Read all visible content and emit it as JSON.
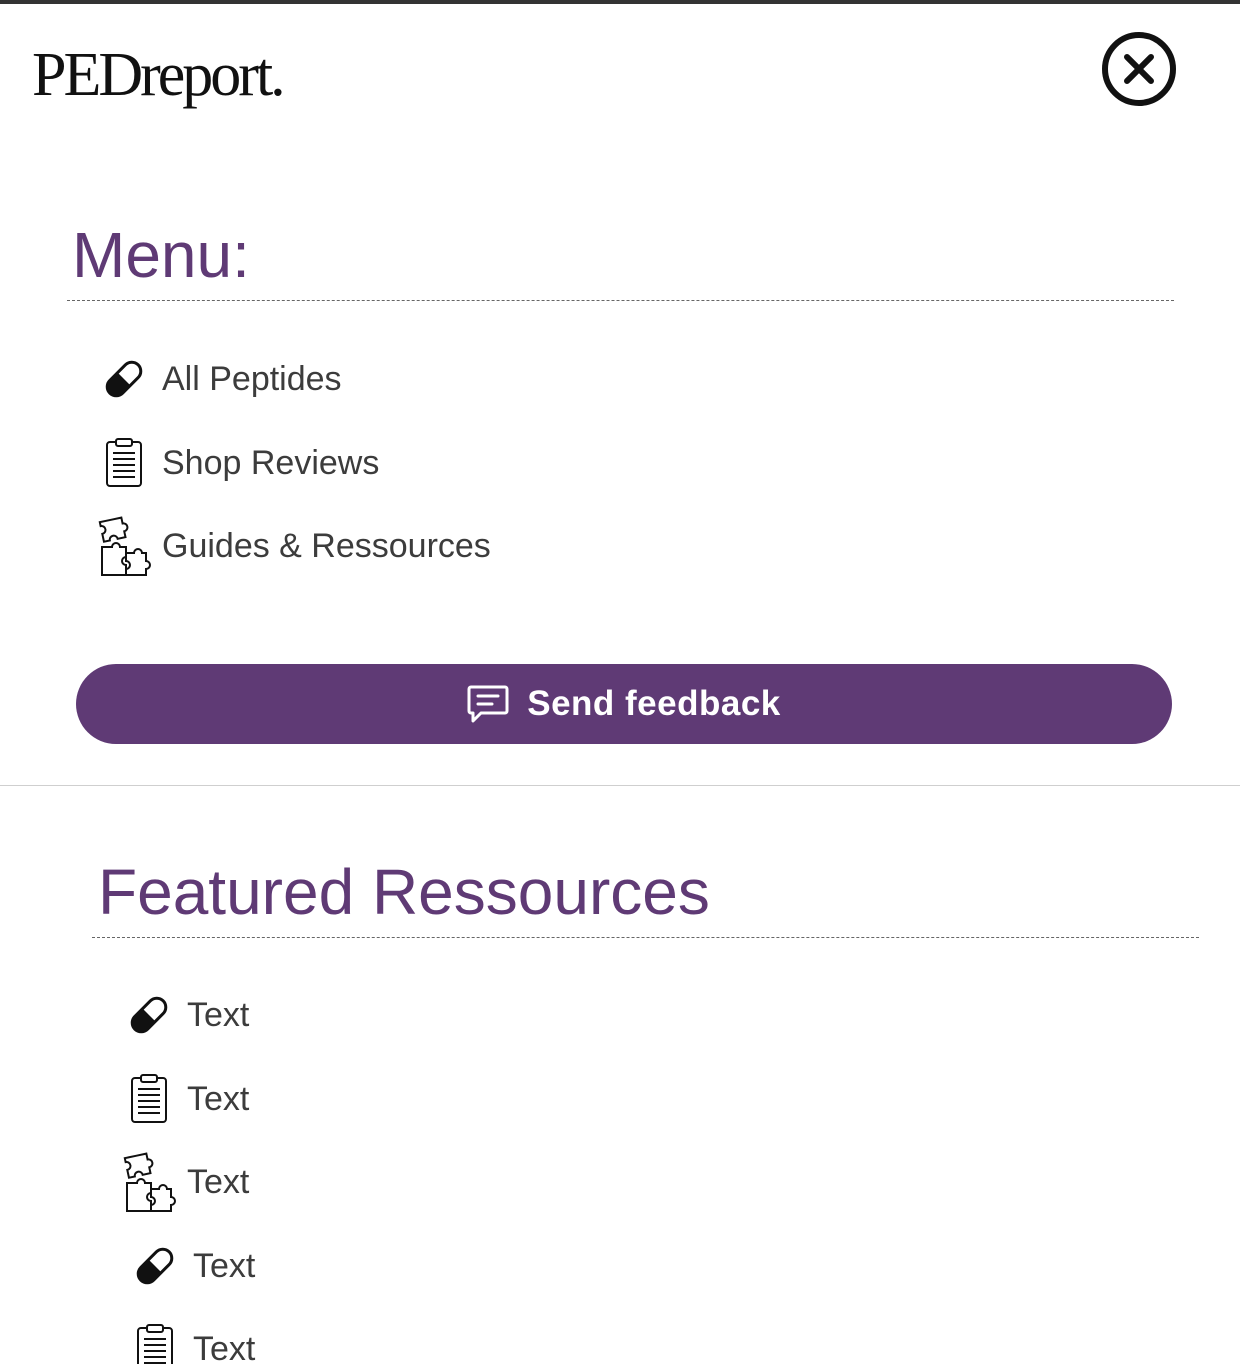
{
  "brand": {
    "logo_text": "PEDreport."
  },
  "colors": {
    "accent": "#5f3a75",
    "button_bg": "#5f3a75",
    "button_text": "#ffffff"
  },
  "close_icon": "close-circle-icon",
  "menu": {
    "title": "Menu:",
    "items": [
      {
        "label": "All Peptides",
        "icon": "pill-icon"
      },
      {
        "label": "Shop Reviews",
        "icon": "clipboard-list-icon"
      },
      {
        "label": "Guides & Ressources",
        "icon": "puzzle-pieces-icon"
      }
    ],
    "feedback_button": {
      "label": "Send feedback",
      "icon": "chat-bubble-icon"
    }
  },
  "featured": {
    "title": "Featured Ressources",
    "items": [
      {
        "label": "Text",
        "icon": "pill-icon"
      },
      {
        "label": "Text",
        "icon": "clipboard-list-icon"
      },
      {
        "label": "Text",
        "icon": "puzzle-pieces-icon"
      },
      {
        "label": "Text",
        "icon": "pill-icon"
      },
      {
        "label": "Text",
        "icon": "clipboard-list-icon"
      }
    ]
  }
}
